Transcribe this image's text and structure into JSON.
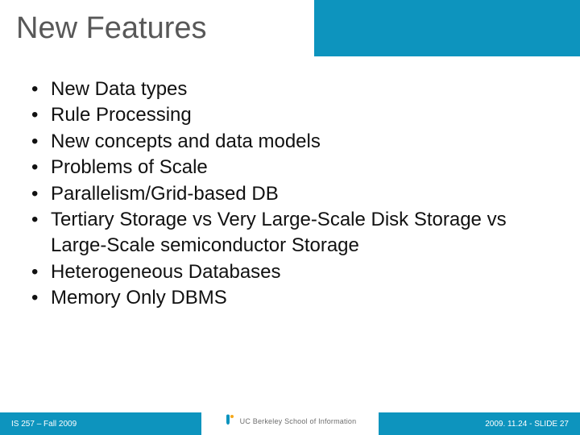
{
  "title": "New Features",
  "bullets": {
    "b0": "New Data types",
    "b1": "Rule Processing",
    "b2": "New concepts and data models",
    "b3": "Problems of Scale",
    "b4": "Parallelism/Grid-based DB",
    "b5": "Tertiary Storage vs Very Large-Scale Disk Storage vs Large-Scale semiconductor Storage",
    "b6": "Heterogeneous Databases",
    "b7": "Memory Only DBMS"
  },
  "footer": {
    "left": "IS 257 – Fall 2009",
    "center": "UC Berkeley School of Information",
    "right": "2009. 11.24 - SLIDE 27"
  }
}
